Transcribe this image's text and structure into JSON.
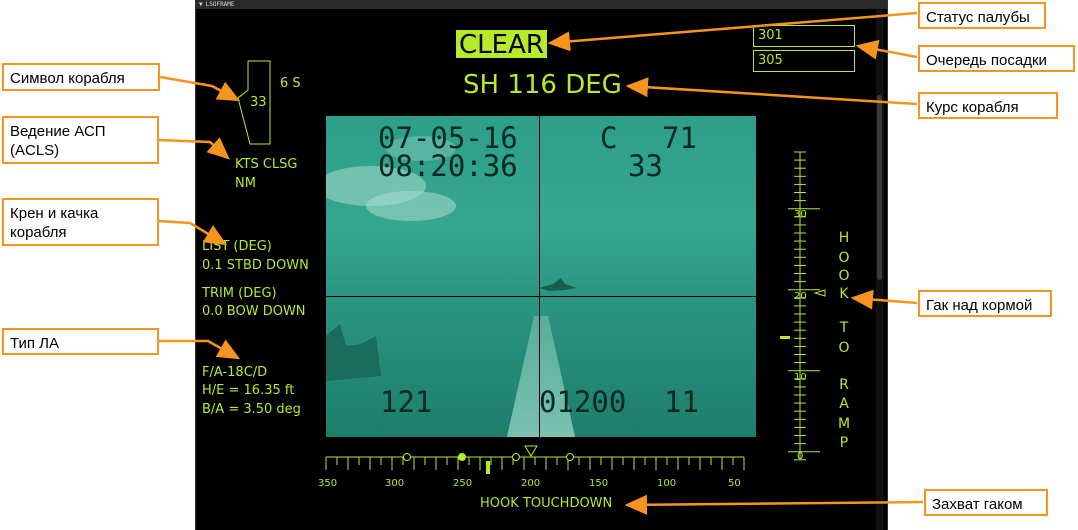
{
  "window": {
    "title": "LSOFRAME"
  },
  "deck_status": "CLEAR",
  "ship_heading": "SH 116 DEG",
  "landing_queue": [
    "301",
    "305"
  ],
  "ship_symbol": {
    "value": "33",
    "position": "6 S"
  },
  "acls": {
    "line1": "KTS CLSG",
    "line2": "NM"
  },
  "list_trim": {
    "list_label": "LIST (DEG)",
    "list_value": "0.1 STBD DOWN",
    "trim_label": "TRIM (DEG)",
    "trim_value": "0.0 BOW DOWN"
  },
  "aircraft": {
    "type": "F/A-18C/D",
    "he": "H/E = 16.35 ft",
    "ba": "B/A = 3.50 deg"
  },
  "camera": {
    "date": "07-05-16",
    "time": "08:20:36",
    "c_label": "C",
    "c_value": "71",
    "c_sub": "33",
    "bottom_left": "121",
    "bottom_mid": "01200",
    "bottom_right": "11"
  },
  "hook_to_ramp": {
    "letters": [
      "H",
      "O",
      "O",
      "K",
      "T",
      "O",
      "R",
      "A",
      "M",
      "P"
    ],
    "scale_labels": [
      "30",
      "20",
      "10",
      "0"
    ]
  },
  "hook_touchdown": {
    "label": "HOOK TOUCHDOWN",
    "scale_labels": [
      "350",
      "300",
      "250",
      "200",
      "150",
      "100",
      "50"
    ]
  },
  "callouts": {
    "deck_status": "Статус палубы",
    "queue": "Очередь посадки",
    "heading": "Курс корабля",
    "hook_over_ramp": "Гак над кормой",
    "hook_catch": "Захват гаком",
    "ship_symbol": "Символ корабля",
    "acls_line1": "Ведение АСП",
    "acls_line2": "(ACLS)",
    "roll_line1": "Крен и качка",
    "roll_line2": "корабля",
    "aircraft_type": "Тип ЛА"
  },
  "colors": {
    "hud": "#b6ea2c",
    "callout_border": "#f7941d",
    "camera": "#2d9f89"
  }
}
